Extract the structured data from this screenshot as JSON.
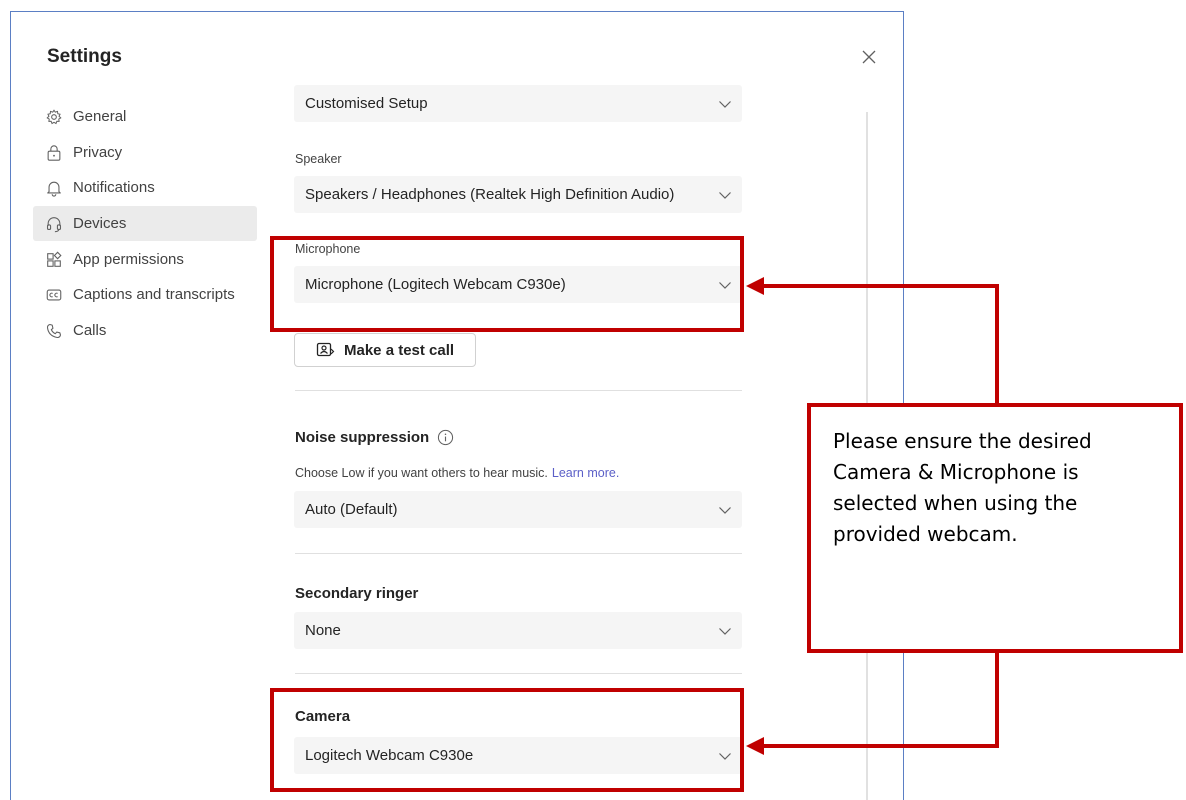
{
  "dialog": {
    "title": "Settings",
    "close_icon": "close-icon"
  },
  "sidebar": {
    "items": [
      {
        "label": "General",
        "icon": "gear-icon",
        "active": false
      },
      {
        "label": "Privacy",
        "icon": "lock-icon",
        "active": false
      },
      {
        "label": "Notifications",
        "icon": "bell-icon",
        "active": false
      },
      {
        "label": "Devices",
        "icon": "headset-icon",
        "active": true
      },
      {
        "label": "App permissions",
        "icon": "apps-icon",
        "active": false
      },
      {
        "label": "Captions and transcripts",
        "icon": "cc-icon",
        "active": false
      },
      {
        "label": "Calls",
        "icon": "phone-icon",
        "active": false
      }
    ]
  },
  "devices": {
    "audio_setup": {
      "value": "Customised Setup"
    },
    "speaker": {
      "label": "Speaker",
      "value": "Speakers / Headphones (Realtek High Definition Audio)"
    },
    "microphone": {
      "label": "Microphone",
      "value": "Microphone (Logitech Webcam C930e)"
    },
    "test_call_button": "Make a test call",
    "noise_suppression": {
      "title": "Noise suppression",
      "help": "Choose Low if you want others to hear music.",
      "link": "Learn more.",
      "value": "Auto (Default)"
    },
    "secondary_ringer": {
      "title": "Secondary ringer",
      "value": "None"
    },
    "camera": {
      "title": "Camera",
      "value": "Logitech Webcam C930e"
    }
  },
  "annotation": {
    "text": "Please ensure the desired Camera & Microphone is selected when using the provided webcam.",
    "color": "#c00000"
  },
  "colors": {
    "accent": "#5b5fc7",
    "dialog_border": "#5b7fc4",
    "annotation_red": "#c00000"
  }
}
